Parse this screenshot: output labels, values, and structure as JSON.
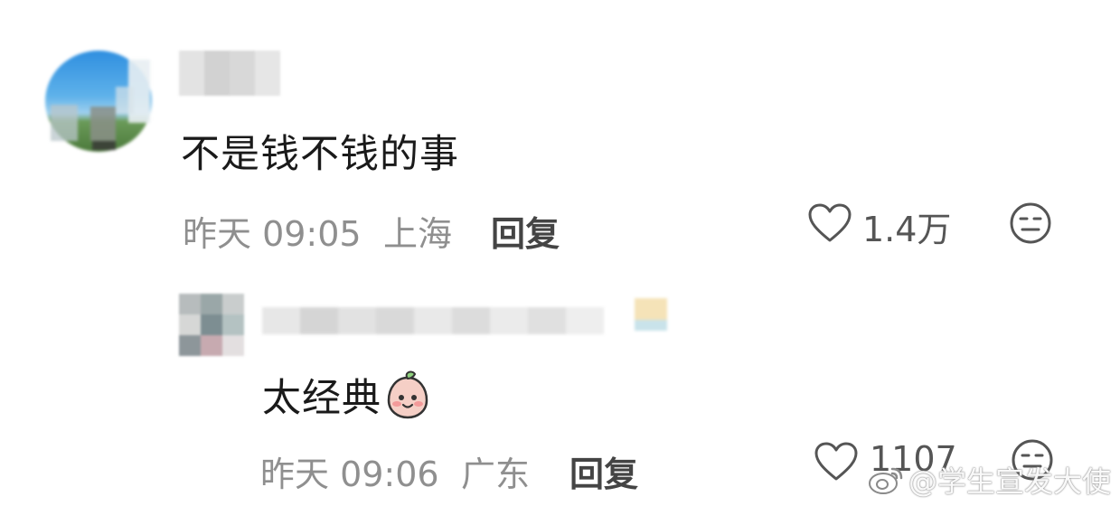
{
  "comments": [
    {
      "text": "不是钱不钱的事",
      "time": "昨天 09:05",
      "location": "上海",
      "reply_label": "回复",
      "like_count": "1.4万"
    },
    {
      "text": "太经典",
      "time": "昨天 09:06",
      "location": "广东",
      "reply_label": "回复",
      "like_count": "1107"
    }
  ],
  "watermark": {
    "text": "@学生宣发大使"
  },
  "colors": {
    "comment_text": "#1a1a1a",
    "meta_text": "#8f8f8f",
    "reply_text": "#444444",
    "icon_stroke": "#555555",
    "background": "#ffffff"
  },
  "icons": {
    "like": "heart-outline-icon",
    "dislike": "neutral-face-icon",
    "emoji": "peach-face-emoji"
  }
}
